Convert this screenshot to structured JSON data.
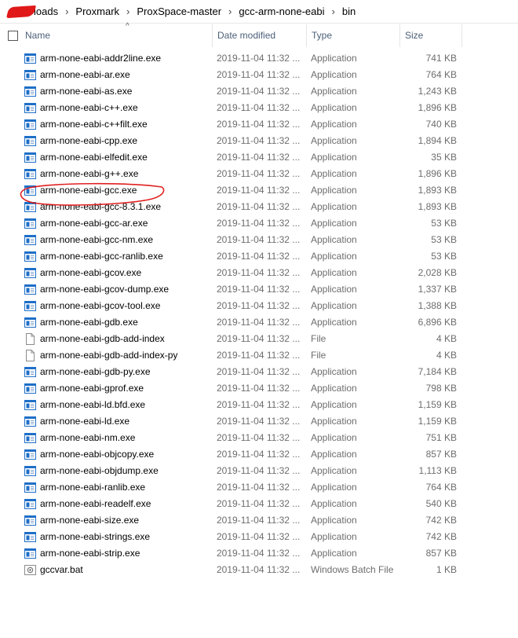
{
  "breadcrumb": {
    "items": [
      "loads",
      "Proxmark",
      "ProxSpace-master",
      "gcc-arm-none-eabi",
      "bin"
    ]
  },
  "columns": {
    "name": "Name",
    "date": "Date modified",
    "type": "Type",
    "size": "Size",
    "sort_indicator": "^"
  },
  "files": [
    {
      "name": "arm-none-eabi-addr2line.exe",
      "date": "2019-11-04 11:32 ...",
      "type": "Application",
      "size": "741 KB",
      "icon": "application-icon"
    },
    {
      "name": "arm-none-eabi-ar.exe",
      "date": "2019-11-04 11:32 ...",
      "type": "Application",
      "size": "764 KB",
      "icon": "application-icon"
    },
    {
      "name": "arm-none-eabi-as.exe",
      "date": "2019-11-04 11:32 ...",
      "type": "Application",
      "size": "1,243 KB",
      "icon": "application-icon"
    },
    {
      "name": "arm-none-eabi-c++.exe",
      "date": "2019-11-04 11:32 ...",
      "type": "Application",
      "size": "1,896 KB",
      "icon": "application-icon"
    },
    {
      "name": "arm-none-eabi-c++filt.exe",
      "date": "2019-11-04 11:32 ...",
      "type": "Application",
      "size": "740 KB",
      "icon": "application-icon"
    },
    {
      "name": "arm-none-eabi-cpp.exe",
      "date": "2019-11-04 11:32 ...",
      "type": "Application",
      "size": "1,894 KB",
      "icon": "application-icon"
    },
    {
      "name": "arm-none-eabi-elfedit.exe",
      "date": "2019-11-04 11:32 ...",
      "type": "Application",
      "size": "35 KB",
      "icon": "application-icon"
    },
    {
      "name": "arm-none-eabi-g++.exe",
      "date": "2019-11-04 11:32 ...",
      "type": "Application",
      "size": "1,896 KB",
      "icon": "application-icon"
    },
    {
      "name": "arm-none-eabi-gcc.exe",
      "date": "2019-11-04 11:32 ...",
      "type": "Application",
      "size": "1,893 KB",
      "icon": "application-icon"
    },
    {
      "name": "arm-none-eabi-gcc-8.3.1.exe",
      "date": "2019-11-04 11:32 ...",
      "type": "Application",
      "size": "1,893 KB",
      "icon": "application-icon"
    },
    {
      "name": "arm-none-eabi-gcc-ar.exe",
      "date": "2019-11-04 11:32 ...",
      "type": "Application",
      "size": "53 KB",
      "icon": "application-icon"
    },
    {
      "name": "arm-none-eabi-gcc-nm.exe",
      "date": "2019-11-04 11:32 ...",
      "type": "Application",
      "size": "53 KB",
      "icon": "application-icon"
    },
    {
      "name": "arm-none-eabi-gcc-ranlib.exe",
      "date": "2019-11-04 11:32 ...",
      "type": "Application",
      "size": "53 KB",
      "icon": "application-icon"
    },
    {
      "name": "arm-none-eabi-gcov.exe",
      "date": "2019-11-04 11:32 ...",
      "type": "Application",
      "size": "2,028 KB",
      "icon": "application-icon"
    },
    {
      "name": "arm-none-eabi-gcov-dump.exe",
      "date": "2019-11-04 11:32 ...",
      "type": "Application",
      "size": "1,337 KB",
      "icon": "application-icon"
    },
    {
      "name": "arm-none-eabi-gcov-tool.exe",
      "date": "2019-11-04 11:32 ...",
      "type": "Application",
      "size": "1,388 KB",
      "icon": "application-icon"
    },
    {
      "name": "arm-none-eabi-gdb.exe",
      "date": "2019-11-04 11:32 ...",
      "type": "Application",
      "size": "6,896 KB",
      "icon": "application-icon"
    },
    {
      "name": "arm-none-eabi-gdb-add-index",
      "date": "2019-11-04 11:32 ...",
      "type": "File",
      "size": "4 KB",
      "icon": "file-icon"
    },
    {
      "name": "arm-none-eabi-gdb-add-index-py",
      "date": "2019-11-04 11:32 ...",
      "type": "File",
      "size": "4 KB",
      "icon": "file-icon"
    },
    {
      "name": "arm-none-eabi-gdb-py.exe",
      "date": "2019-11-04 11:32 ...",
      "type": "Application",
      "size": "7,184 KB",
      "icon": "application-icon"
    },
    {
      "name": "arm-none-eabi-gprof.exe",
      "date": "2019-11-04 11:32 ...",
      "type": "Application",
      "size": "798 KB",
      "icon": "application-icon"
    },
    {
      "name": "arm-none-eabi-ld.bfd.exe",
      "date": "2019-11-04 11:32 ...",
      "type": "Application",
      "size": "1,159 KB",
      "icon": "application-icon"
    },
    {
      "name": "arm-none-eabi-ld.exe",
      "date": "2019-11-04 11:32 ...",
      "type": "Application",
      "size": "1,159 KB",
      "icon": "application-icon"
    },
    {
      "name": "arm-none-eabi-nm.exe",
      "date": "2019-11-04 11:32 ...",
      "type": "Application",
      "size": "751 KB",
      "icon": "application-icon"
    },
    {
      "name": "arm-none-eabi-objcopy.exe",
      "date": "2019-11-04 11:32 ...",
      "type": "Application",
      "size": "857 KB",
      "icon": "application-icon"
    },
    {
      "name": "arm-none-eabi-objdump.exe",
      "date": "2019-11-04 11:32 ...",
      "type": "Application",
      "size": "1,113 KB",
      "icon": "application-icon"
    },
    {
      "name": "arm-none-eabi-ranlib.exe",
      "date": "2019-11-04 11:32 ...",
      "type": "Application",
      "size": "764 KB",
      "icon": "application-icon"
    },
    {
      "name": "arm-none-eabi-readelf.exe",
      "date": "2019-11-04 11:32 ...",
      "type": "Application",
      "size": "540 KB",
      "icon": "application-icon"
    },
    {
      "name": "arm-none-eabi-size.exe",
      "date": "2019-11-04 11:32 ...",
      "type": "Application",
      "size": "742 KB",
      "icon": "application-icon"
    },
    {
      "name": "arm-none-eabi-strings.exe",
      "date": "2019-11-04 11:32 ...",
      "type": "Application",
      "size": "742 KB",
      "icon": "application-icon"
    },
    {
      "name": "arm-none-eabi-strip.exe",
      "date": "2019-11-04 11:32 ...",
      "type": "Application",
      "size": "857 KB",
      "icon": "application-icon"
    },
    {
      "name": "gccvar.bat",
      "date": "2019-11-04 11:32 ...",
      "type": "Windows Batch File",
      "size": "1 KB",
      "icon": "batch-file-icon"
    }
  ],
  "annotation": {
    "target": "arm-none-eabi-gcc.exe",
    "color": "#e02020"
  },
  "colors": {
    "header_text": "#4c607a",
    "detail_text": "#6d6d6d",
    "app_icon_blue": "#1f6fc8",
    "redaction": "#e01818"
  }
}
